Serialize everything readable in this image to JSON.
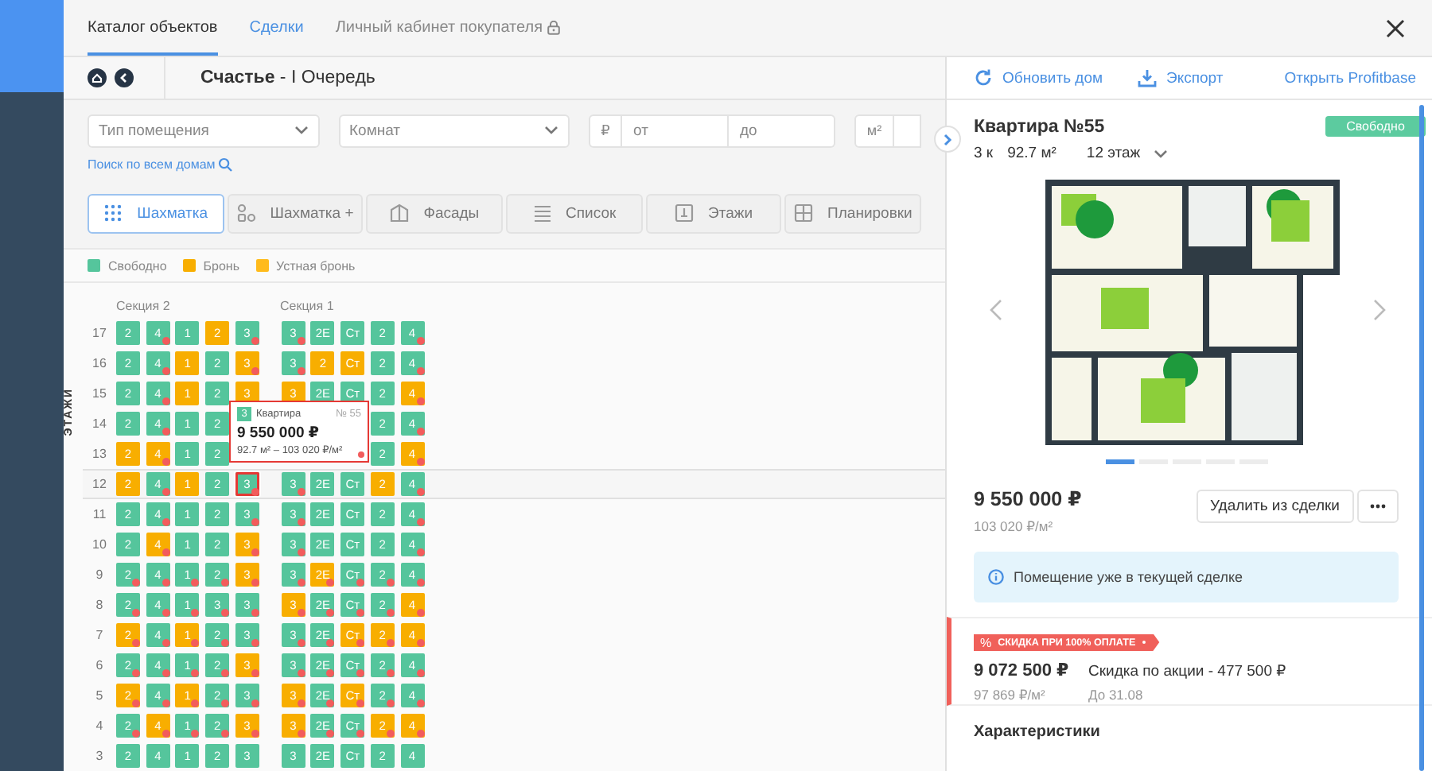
{
  "top_tabs": [
    {
      "label": "Каталог объектов",
      "selected": true,
      "kind": "tab"
    },
    {
      "label": "Сделки",
      "selected": false,
      "kind": "link"
    },
    {
      "label": "Личный кабинет покупателя",
      "selected": false,
      "kind": "locked"
    }
  ],
  "breadcrumb": {
    "title": "**Счастье** - I Очередь"
  },
  "filters": {
    "room_type": {
      "placeholder": "Тип помещения"
    },
    "rooms": {
      "placeholder": "Комнат"
    },
    "price": {
      "unit": "₽",
      "from": {
        "placeholder": "от"
      },
      "to": {
        "placeholder": "до"
      }
    },
    "area": {
      "unit": "м²"
    },
    "search_all": "Поиск по всем домам"
  },
  "view_tabs": [
    {
      "label": "Шахматка",
      "kind": "grid",
      "selected": true
    },
    {
      "label": "Шахматка +",
      "kind": "grid-plus",
      "selected": false
    },
    {
      "label": "Фасады",
      "kind": "facade",
      "selected": false
    },
    {
      "label": "Список",
      "kind": "list",
      "selected": false
    },
    {
      "label": "Этажи",
      "kind": "floors",
      "selected": false
    },
    {
      "label": "Планировки",
      "kind": "plans",
      "selected": false
    }
  ],
  "legend": [
    {
      "label": "Свободно",
      "color": "#55c59c"
    },
    {
      "label": "Бронь",
      "color": "#f8ae00"
    },
    {
      "label": "Устная бронь",
      "color": "#ffbb1c"
    }
  ],
  "grid": {
    "axis_label": "ЭТАЖИ",
    "sections": [
      "Секция 2",
      "Секция 1"
    ],
    "floors": [
      {
        "floor": "17",
        "highlighted": false,
        "cells": [
          [
            {
              "label": "2",
              "booked": false,
              "dot": false,
              "selected": false
            },
            {
              "label": "4",
              "booked": false,
              "dot": true,
              "selected": false
            },
            {
              "label": "1",
              "booked": false,
              "dot": false,
              "selected": false
            },
            {
              "label": "2",
              "booked": true,
              "dot": false,
              "selected": false
            },
            {
              "label": "3",
              "booked": false,
              "dot": true,
              "selected": false
            }
          ],
          [
            {
              "label": "3",
              "booked": false,
              "dot": true,
              "selected": false
            },
            {
              "label": "2Е",
              "booked": false,
              "dot": false,
              "selected": false
            },
            {
              "label": "Ст",
              "booked": false,
              "dot": false,
              "selected": false
            },
            {
              "label": "2",
              "booked": false,
              "dot": false,
              "selected": false
            },
            {
              "label": "4",
              "booked": false,
              "dot": true,
              "selected": false
            }
          ]
        ]
      },
      {
        "floor": "16",
        "highlighted": false,
        "cells": [
          [
            {
              "label": "2",
              "booked": false,
              "dot": false,
              "selected": false
            },
            {
              "label": "4",
              "booked": false,
              "dot": true,
              "selected": false
            },
            {
              "label": "1",
              "booked": true,
              "dot": false,
              "selected": false
            },
            {
              "label": "2",
              "booked": false,
              "dot": false,
              "selected": false
            },
            {
              "label": "3",
              "booked": true,
              "dot": true,
              "selected": false
            }
          ],
          [
            {
              "label": "3",
              "booked": false,
              "dot": true,
              "selected": false
            },
            {
              "label": "2",
              "booked": true,
              "dot": false,
              "selected": false
            },
            {
              "label": "Ст",
              "booked": true,
              "dot": false,
              "selected": false
            },
            {
              "label": "2",
              "booked": false,
              "dot": false,
              "selected": false
            },
            {
              "label": "4",
              "booked": false,
              "dot": true,
              "selected": false
            }
          ]
        ]
      },
      {
        "floor": "15",
        "highlighted": false,
        "cells": [
          [
            {
              "label": "2",
              "booked": false,
              "dot": false,
              "selected": false
            },
            {
              "label": "4",
              "booked": false,
              "dot": true,
              "selected": false
            },
            {
              "label": "1",
              "booked": true,
              "dot": false,
              "selected": false
            },
            {
              "label": "2",
              "booked": false,
              "dot": false,
              "selected": false
            },
            {
              "label": "3",
              "booked": true,
              "dot": false,
              "selected": false
            }
          ],
          [
            {
              "label": "3",
              "booked": true,
              "dot": false,
              "selected": false
            },
            {
              "label": "2Е",
              "booked": false,
              "dot": false,
              "selected": false
            },
            {
              "label": "Ст",
              "booked": false,
              "dot": false,
              "selected": false
            },
            {
              "label": "2",
              "booked": false,
              "dot": false,
              "selected": false
            },
            {
              "label": "4",
              "booked": true,
              "dot": true,
              "selected": false
            }
          ]
        ]
      },
      {
        "floor": "14",
        "highlighted": false,
        "cells": [
          [
            {
              "label": "2",
              "booked": false,
              "dot": false,
              "selected": false
            },
            {
              "label": "4",
              "booked": false,
              "dot": true,
              "selected": false
            },
            {
              "label": "1",
              "booked": false,
              "dot": false,
              "selected": false
            },
            {
              "label": "2",
              "booked": false,
              "dot": false,
              "selected": false
            },
            null
          ],
          [
            null,
            null,
            null,
            {
              "label": "2",
              "booked": false,
              "dot": false,
              "selected": false
            },
            {
              "label": "4",
              "booked": false,
              "dot": true,
              "selected": false
            }
          ]
        ]
      },
      {
        "floor": "13",
        "highlighted": false,
        "cells": [
          [
            {
              "label": "2",
              "booked": true,
              "dot": false,
              "selected": false
            },
            {
              "label": "4",
              "booked": true,
              "dot": true,
              "selected": false
            },
            {
              "label": "1",
              "booked": false,
              "dot": false,
              "selected": false
            },
            {
              "label": "2",
              "booked": false,
              "dot": false,
              "selected": false
            },
            null
          ],
          [
            null,
            null,
            null,
            {
              "label": "2",
              "booked": false,
              "dot": false,
              "selected": false
            },
            {
              "label": "4",
              "booked": true,
              "dot": true,
              "selected": false
            }
          ]
        ]
      },
      {
        "floor": "12",
        "highlighted": true,
        "cells": [
          [
            {
              "label": "2",
              "booked": true,
              "dot": false,
              "selected": false
            },
            {
              "label": "4",
              "booked": false,
              "dot": true,
              "selected": false
            },
            {
              "label": "1",
              "booked": true,
              "dot": false,
              "selected": false
            },
            {
              "label": "2",
              "booked": false,
              "dot": false,
              "selected": false
            },
            {
              "label": "3",
              "booked": false,
              "dot": true,
              "selected": true
            }
          ],
          [
            {
              "label": "3",
              "booked": false,
              "dot": true,
              "selected": false
            },
            {
              "label": "2Е",
              "booked": false,
              "dot": false,
              "selected": false
            },
            {
              "label": "Ст",
              "booked": false,
              "dot": false,
              "selected": false
            },
            {
              "label": "2",
              "booked": true,
              "dot": false,
              "selected": false
            },
            {
              "label": "4",
              "booked": false,
              "dot": true,
              "selected": false
            }
          ]
        ]
      },
      {
        "floor": "11",
        "highlighted": false,
        "cells": [
          [
            {
              "label": "2",
              "booked": false,
              "dot": false,
              "selected": false
            },
            {
              "label": "4",
              "booked": false,
              "dot": true,
              "selected": false
            },
            {
              "label": "1",
              "booked": false,
              "dot": false,
              "selected": false
            },
            {
              "label": "2",
              "booked": false,
              "dot": false,
              "selected": false
            },
            {
              "label": "3",
              "booked": false,
              "dot": true,
              "selected": false
            }
          ],
          [
            {
              "label": "3",
              "booked": false,
              "dot": true,
              "selected": false
            },
            {
              "label": "2Е",
              "booked": false,
              "dot": false,
              "selected": false
            },
            {
              "label": "Ст",
              "booked": false,
              "dot": false,
              "selected": false
            },
            {
              "label": "2",
              "booked": false,
              "dot": false,
              "selected": false
            },
            {
              "label": "4",
              "booked": false,
              "dot": true,
              "selected": false
            }
          ]
        ]
      },
      {
        "floor": "10",
        "highlighted": false,
        "cells": [
          [
            {
              "label": "2",
              "booked": false,
              "dot": false,
              "selected": false
            },
            {
              "label": "4",
              "booked": true,
              "dot": true,
              "selected": false
            },
            {
              "label": "1",
              "booked": false,
              "dot": false,
              "selected": false
            },
            {
              "label": "2",
              "booked": false,
              "dot": false,
              "selected": false
            },
            {
              "label": "3",
              "booked": true,
              "dot": true,
              "selected": false
            }
          ],
          [
            {
              "label": "3",
              "booked": false,
              "dot": true,
              "selected": false
            },
            {
              "label": "2Е",
              "booked": false,
              "dot": false,
              "selected": false
            },
            {
              "label": "Ст",
              "booked": false,
              "dot": false,
              "selected": false
            },
            {
              "label": "2",
              "booked": false,
              "dot": false,
              "selected": false
            },
            {
              "label": "4",
              "booked": false,
              "dot": true,
              "selected": false
            }
          ]
        ]
      },
      {
        "floor": "9",
        "highlighted": false,
        "cells": [
          [
            {
              "label": "2",
              "booked": false,
              "dot": true,
              "selected": false
            },
            {
              "label": "4",
              "booked": false,
              "dot": true,
              "selected": false
            },
            {
              "label": "1",
              "booked": false,
              "dot": true,
              "selected": false
            },
            {
              "label": "2",
              "booked": false,
              "dot": true,
              "selected": false
            },
            {
              "label": "3",
              "booked": true,
              "dot": true,
              "selected": false
            }
          ],
          [
            {
              "label": "3",
              "booked": false,
              "dot": true,
              "selected": false
            },
            {
              "label": "2Е",
              "booked": true,
              "dot": true,
              "selected": false
            },
            {
              "label": "Ст",
              "booked": false,
              "dot": true,
              "selected": false
            },
            {
              "label": "2",
              "booked": false,
              "dot": true,
              "selected": false
            },
            {
              "label": "4",
              "booked": false,
              "dot": true,
              "selected": false
            }
          ]
        ]
      },
      {
        "floor": "8",
        "highlighted": false,
        "cells": [
          [
            {
              "label": "2",
              "booked": false,
              "dot": true,
              "selected": false
            },
            {
              "label": "4",
              "booked": false,
              "dot": true,
              "selected": false
            },
            {
              "label": "1",
              "booked": false,
              "dot": true,
              "selected": false
            },
            {
              "label": "3",
              "booked": false,
              "dot": true,
              "selected": false
            },
            {
              "label": "3",
              "booked": false,
              "dot": true,
              "selected": false
            }
          ],
          [
            {
              "label": "3",
              "booked": true,
              "dot": true,
              "selected": false
            },
            {
              "label": "2Е",
              "booked": false,
              "dot": true,
              "selected": false
            },
            {
              "label": "Ст",
              "booked": false,
              "dot": true,
              "selected": false
            },
            {
              "label": "2",
              "booked": false,
              "dot": true,
              "selected": false
            },
            {
              "label": "4",
              "booked": true,
              "dot": true,
              "selected": false
            }
          ]
        ]
      },
      {
        "floor": "7",
        "highlighted": false,
        "cells": [
          [
            {
              "label": "2",
              "booked": true,
              "dot": true,
              "selected": false
            },
            {
              "label": "4",
              "booked": false,
              "dot": true,
              "selected": false
            },
            {
              "label": "1",
              "booked": true,
              "dot": true,
              "selected": false
            },
            {
              "label": "2",
              "booked": false,
              "dot": true,
              "selected": false
            },
            {
              "label": "3",
              "booked": false,
              "dot": true,
              "selected": false
            }
          ],
          [
            {
              "label": "3",
              "booked": false,
              "dot": true,
              "selected": false
            },
            {
              "label": "2Е",
              "booked": false,
              "dot": true,
              "selected": false
            },
            {
              "label": "Ст",
              "booked": true,
              "dot": true,
              "selected": false
            },
            {
              "label": "2",
              "booked": true,
              "dot": true,
              "selected": false
            },
            {
              "label": "4",
              "booked": true,
              "dot": true,
              "selected": false
            }
          ]
        ]
      },
      {
        "floor": "6",
        "highlighted": false,
        "cells": [
          [
            {
              "label": "2",
              "booked": false,
              "dot": true,
              "selected": false
            },
            {
              "label": "4",
              "booked": false,
              "dot": true,
              "selected": false
            },
            {
              "label": "1",
              "booked": false,
              "dot": true,
              "selected": false
            },
            {
              "label": "2",
              "booked": false,
              "dot": true,
              "selected": false
            },
            {
              "label": "3",
              "booked": true,
              "dot": true,
              "selected": false
            }
          ],
          [
            {
              "label": "3",
              "booked": false,
              "dot": true,
              "selected": false
            },
            {
              "label": "2Е",
              "booked": false,
              "dot": true,
              "selected": false
            },
            {
              "label": "Ст",
              "booked": false,
              "dot": true,
              "selected": false
            },
            {
              "label": "2",
              "booked": false,
              "dot": true,
              "selected": false
            },
            {
              "label": "4",
              "booked": false,
              "dot": true,
              "selected": false
            }
          ]
        ]
      },
      {
        "floor": "5",
        "highlighted": false,
        "cells": [
          [
            {
              "label": "2",
              "booked": true,
              "dot": true,
              "selected": false
            },
            {
              "label": "4",
              "booked": false,
              "dot": true,
              "selected": false
            },
            {
              "label": "1",
              "booked": true,
              "dot": true,
              "selected": false
            },
            {
              "label": "2",
              "booked": false,
              "dot": true,
              "selected": false
            },
            {
              "label": "3",
              "booked": false,
              "dot": true,
              "selected": false
            }
          ],
          [
            {
              "label": "3",
              "booked": true,
              "dot": true,
              "selected": false
            },
            {
              "label": "2Е",
              "booked": false,
              "dot": true,
              "selected": false
            },
            {
              "label": "Ст",
              "booked": true,
              "dot": true,
              "selected": false
            },
            {
              "label": "2",
              "booked": false,
              "dot": true,
              "selected": false
            },
            {
              "label": "4",
              "booked": false,
              "dot": true,
              "selected": false
            }
          ]
        ]
      },
      {
        "floor": "4",
        "highlighted": false,
        "cells": [
          [
            {
              "label": "2",
              "booked": false,
              "dot": true,
              "selected": false
            },
            {
              "label": "4",
              "booked": true,
              "dot": true,
              "selected": false
            },
            {
              "label": "1",
              "booked": false,
              "dot": true,
              "selected": false
            },
            {
              "label": "2",
              "booked": false,
              "dot": true,
              "selected": false
            },
            {
              "label": "3",
              "booked": true,
              "dot": true,
              "selected": false
            }
          ],
          [
            {
              "label": "3",
              "booked": true,
              "dot": true,
              "selected": false
            },
            {
              "label": "2Е",
              "booked": false,
              "dot": true,
              "selected": false
            },
            {
              "label": "Ст",
              "booked": false,
              "dot": true,
              "selected": false
            },
            {
              "label": "2",
              "booked": true,
              "dot": true,
              "selected": false
            },
            {
              "label": "4",
              "booked": true,
              "dot": true,
              "selected": false
            }
          ]
        ]
      },
      {
        "floor": "3",
        "highlighted": false,
        "cells": [
          [
            {
              "label": "2",
              "booked": false,
              "dot": false,
              "selected": false
            },
            {
              "label": "4",
              "booked": false,
              "dot": false,
              "selected": false
            },
            {
              "label": "1",
              "booked": false,
              "dot": false,
              "selected": false
            },
            {
              "label": "2",
              "booked": false,
              "dot": false,
              "selected": false
            },
            {
              "label": "3",
              "booked": false,
              "dot": false,
              "selected": false
            }
          ],
          [
            {
              "label": "3",
              "booked": false,
              "dot": false,
              "selected": false
            },
            {
              "label": "2Е",
              "booked": false,
              "dot": false,
              "selected": false
            },
            {
              "label": "Ст",
              "booked": false,
              "dot": false,
              "selected": false
            },
            {
              "label": "2",
              "booked": false,
              "dot": false,
              "selected": false
            },
            {
              "label": "4",
              "booked": false,
              "dot": false,
              "selected": false
            }
          ]
        ]
      }
    ]
  },
  "tooltip": {
    "badge": "3",
    "booked": false,
    "type": "Квартира",
    "number": "№ 55",
    "price": "9 550 000 ₽",
    "details": "92.7 м² – 103 020 ₽/м²"
  },
  "actions": [
    {
      "label": "Обновить дом",
      "kind": "refresh"
    },
    {
      "label": "Экспорт",
      "kind": "export"
    },
    {
      "label": "Открыть Profitbase",
      "kind": "link"
    }
  ],
  "flat": {
    "title": "Квартира №55",
    "status": "Свободно",
    "rooms": "3 к",
    "area": "92.7 м²",
    "floor": "12 этаж",
    "slides": [
      {
        "selected": true
      },
      {
        "selected": false
      },
      {
        "selected": false
      },
      {
        "selected": false
      },
      {
        "selected": false
      }
    ],
    "price": "9 550 000 ₽",
    "price_per_m2": "103 020 ₽/м²",
    "remove_button": "Удалить из сделки",
    "notice": "Помещение уже в текущей сделке",
    "promo": {
      "icon": "%",
      "tag": "СКИДКА ПРИ 100% ОПЛАТЕ",
      "price": "9 072 500 ₽",
      "price_per_m2": "97 869 ₽/м²",
      "discount": "Скидка по акции - 477 500 ₽",
      "until": "До 31.08"
    },
    "characteristics_title": "Характеристики"
  }
}
